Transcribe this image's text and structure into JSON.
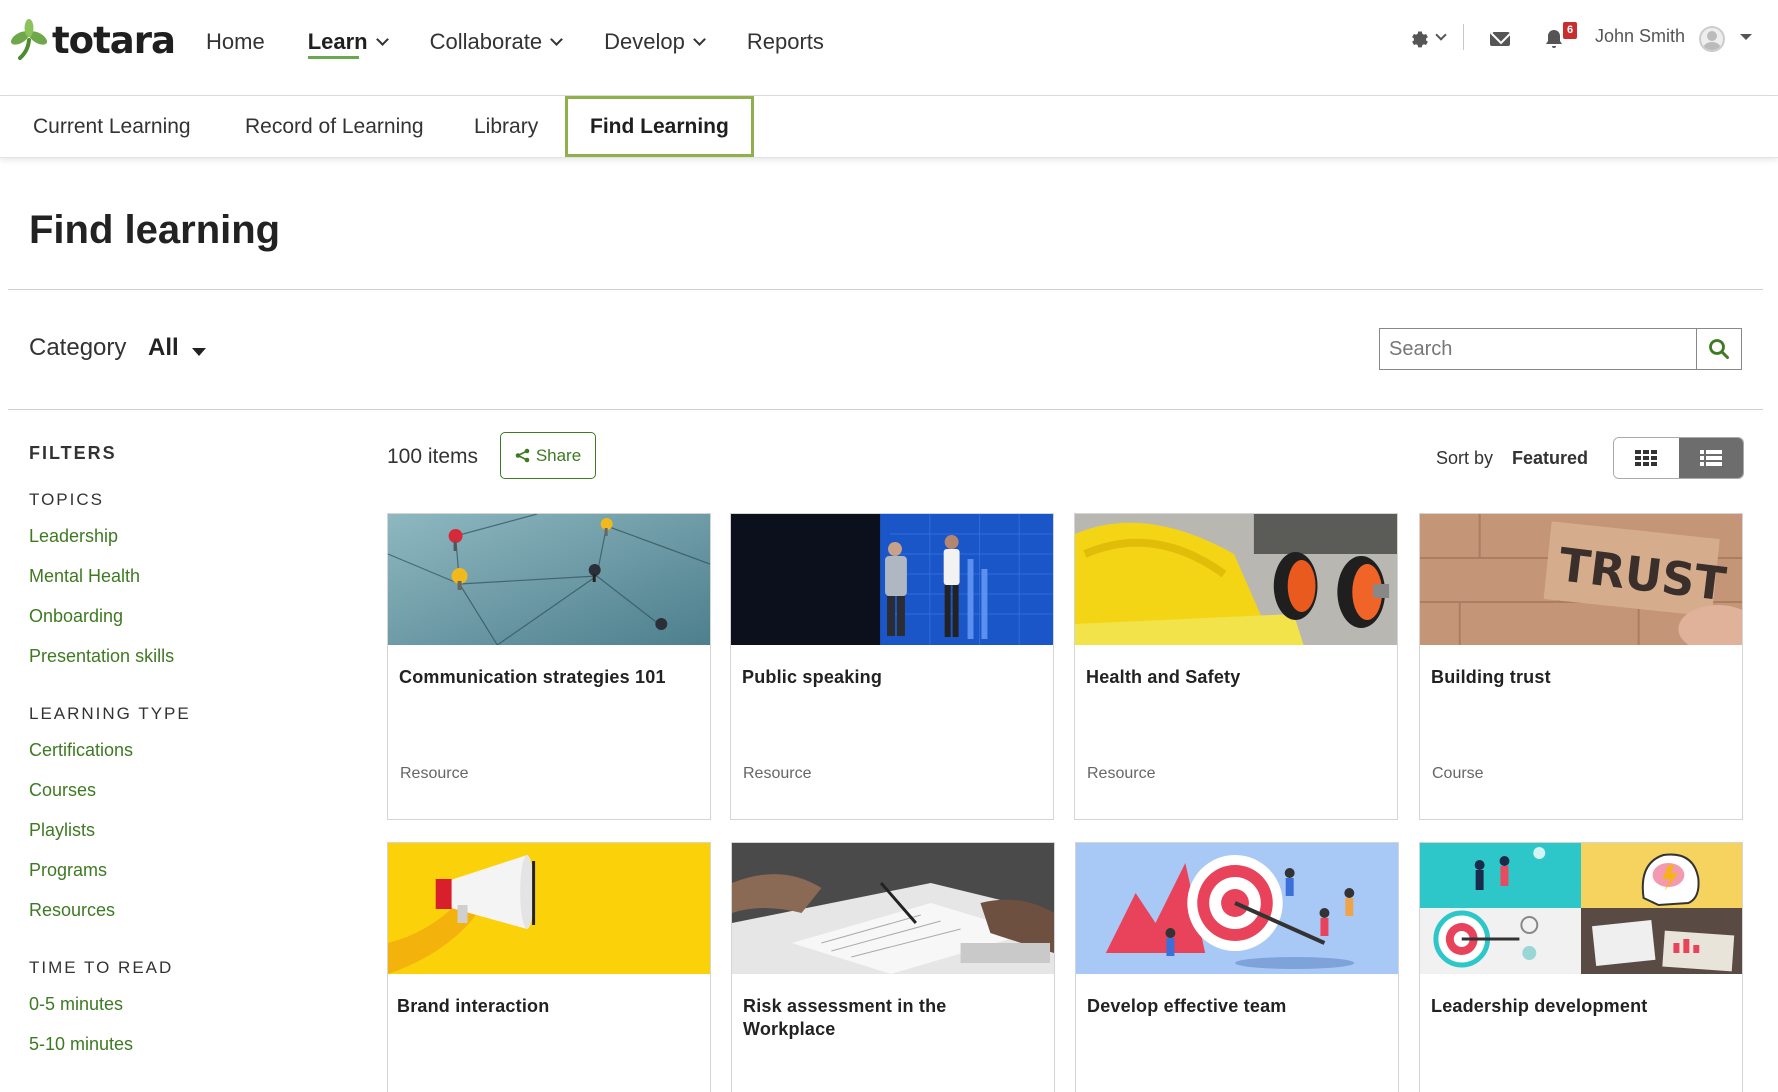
{
  "brand": {
    "name": "totara",
    "accent": "#69a84f",
    "link_color": "#3e7a22"
  },
  "topnav": {
    "items": [
      {
        "label": "Home",
        "active": false,
        "dropdown": false
      },
      {
        "label": "Learn",
        "active": true,
        "dropdown": true
      },
      {
        "label": "Collaborate",
        "active": false,
        "dropdown": true
      },
      {
        "label": "Develop",
        "active": false,
        "dropdown": true
      },
      {
        "label": "Reports",
        "active": false,
        "dropdown": false
      }
    ],
    "notification_count": "6",
    "user_name": "John Smith"
  },
  "subnav": {
    "tabs": [
      {
        "label": "Current Learning",
        "active": false
      },
      {
        "label": "Record of Learning",
        "active": false
      },
      {
        "label": "Library",
        "active": false
      },
      {
        "label": "Find Learning",
        "active": true
      }
    ]
  },
  "page": {
    "title": "Find learning",
    "category_label": "Category",
    "category_value": "All",
    "search_placeholder": "Search"
  },
  "filters": {
    "title": "FILTERS",
    "groups": [
      {
        "label": "TOPICS",
        "items": [
          "Leadership",
          "Mental Health",
          "Onboarding",
          "Presentation skills"
        ]
      },
      {
        "label": "LEARNING TYPE",
        "items": [
          "Certifications",
          "Courses",
          "Playlists",
          "Programs",
          "Resources"
        ]
      },
      {
        "label": "TIME TO READ",
        "items": [
          "0-5 minutes",
          "5-10 minutes"
        ]
      }
    ]
  },
  "results": {
    "count": "100 items",
    "share_label": "Share",
    "sort_label": "Sort by",
    "sort_value": "Featured",
    "view_mode": "grid",
    "cards": [
      {
        "title": "Communication strategies 101",
        "type": "Resource",
        "image": "pins-network"
      },
      {
        "title": "Public speaking",
        "type": "Resource",
        "image": "presenters-stage"
      },
      {
        "title": "Health and Safety",
        "type": "Resource",
        "image": "hard-hat-earmuffs"
      },
      {
        "title": "Building trust",
        "type": "Course",
        "image": "trust-blocks"
      },
      {
        "title": "Brand interaction",
        "type": "",
        "image": "megaphone-yellow"
      },
      {
        "title": "Risk assessment in the Workplace",
        "type": "",
        "image": "desk-paperwork"
      },
      {
        "title": "Develop effective team",
        "type": "",
        "image": "target-team-illustration"
      },
      {
        "title": "Leadership development",
        "type": "",
        "image": "leadership-collage"
      }
    ]
  }
}
